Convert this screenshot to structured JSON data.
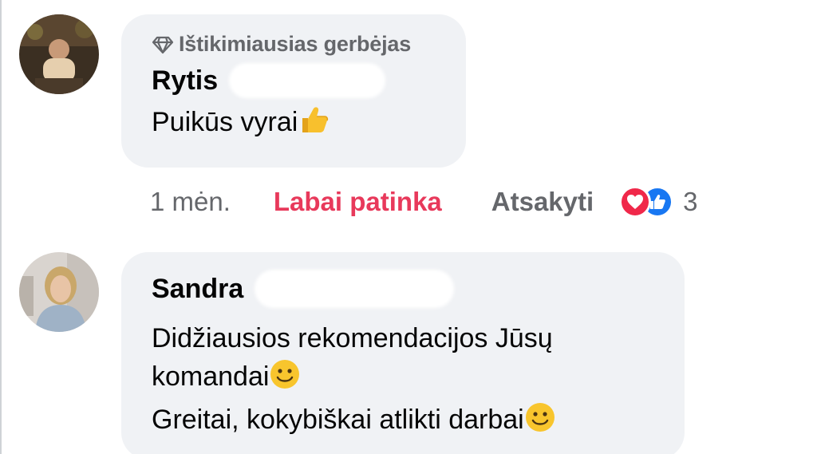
{
  "comments": [
    {
      "badge": "Ištikimiausias gerbėjas",
      "author": "Rytis",
      "lines": [
        "Puikūs vyrai"
      ],
      "line_emoji": [
        "thumbs-up-icon"
      ],
      "meta": {
        "time": "1 mėn.",
        "like_label": "Labai patinka",
        "reply_label": "Atsakyti",
        "reaction_count": "3",
        "reaction_icons": [
          "love-reaction-icon",
          "like-reaction-icon"
        ]
      }
    },
    {
      "author": "Sandra",
      "lines": [
        "Didžiausios rekomendacijos Jūsų",
        "komandai",
        "Greitai, kokybiškai atlikti darbai"
      ],
      "line_emoji": [
        "",
        "smiling-face-icon",
        "smiling-face-icon"
      ]
    }
  ],
  "colors": {
    "bubble_bg": "#f0f2f5",
    "liked_red": "#e8395b",
    "secondary_text": "#65676b",
    "love_red": "#f0284a",
    "like_blue": "#1877f2"
  }
}
